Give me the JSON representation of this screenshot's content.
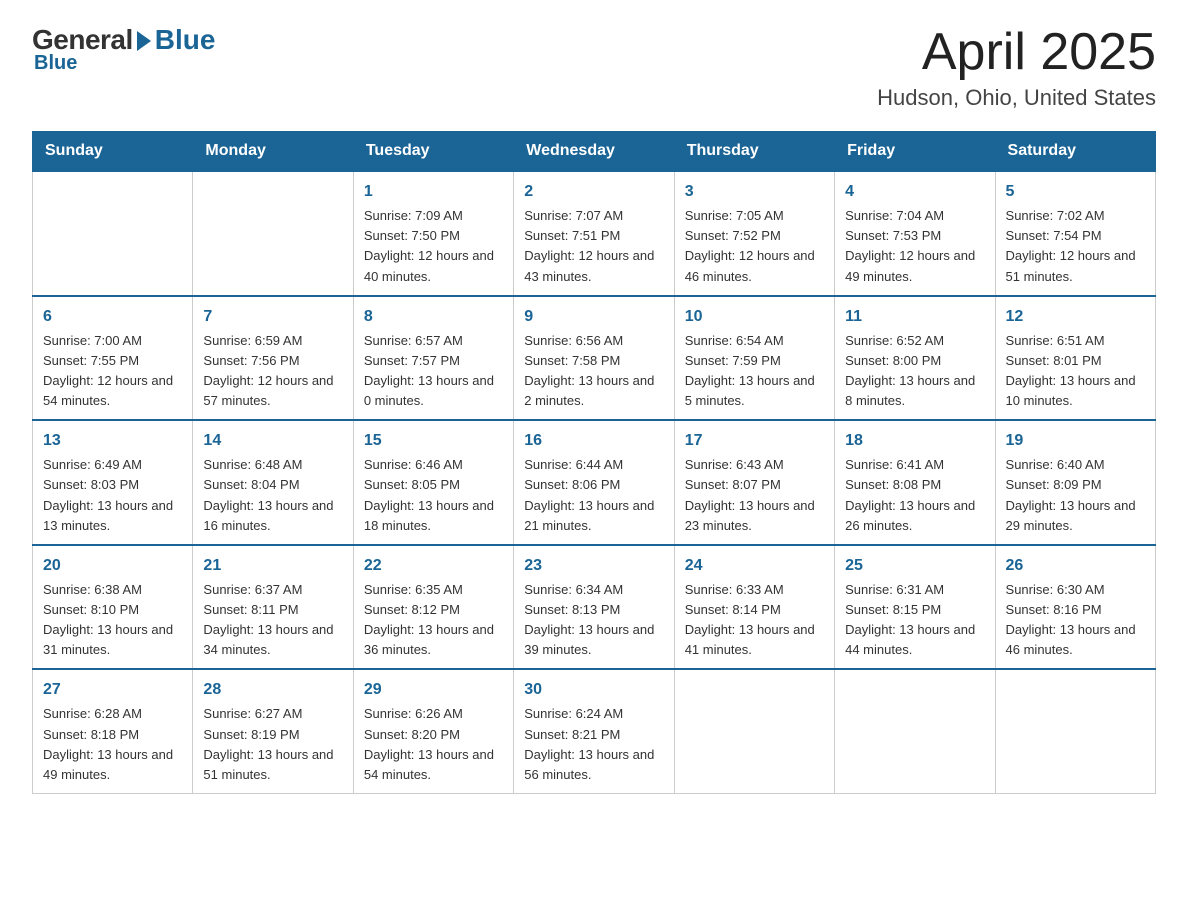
{
  "logo": {
    "general": "General",
    "blue": "Blue",
    "tagline": "Blue"
  },
  "header": {
    "month_year": "April 2025",
    "location": "Hudson, Ohio, United States"
  },
  "weekdays": [
    "Sunday",
    "Monday",
    "Tuesday",
    "Wednesday",
    "Thursday",
    "Friday",
    "Saturday"
  ],
  "weeks": [
    [
      {
        "day": "",
        "info": ""
      },
      {
        "day": "",
        "info": ""
      },
      {
        "day": "1",
        "info": "Sunrise: 7:09 AM\nSunset: 7:50 PM\nDaylight: 12 hours\nand 40 minutes."
      },
      {
        "day": "2",
        "info": "Sunrise: 7:07 AM\nSunset: 7:51 PM\nDaylight: 12 hours\nand 43 minutes."
      },
      {
        "day": "3",
        "info": "Sunrise: 7:05 AM\nSunset: 7:52 PM\nDaylight: 12 hours\nand 46 minutes."
      },
      {
        "day": "4",
        "info": "Sunrise: 7:04 AM\nSunset: 7:53 PM\nDaylight: 12 hours\nand 49 minutes."
      },
      {
        "day": "5",
        "info": "Sunrise: 7:02 AM\nSunset: 7:54 PM\nDaylight: 12 hours\nand 51 minutes."
      }
    ],
    [
      {
        "day": "6",
        "info": "Sunrise: 7:00 AM\nSunset: 7:55 PM\nDaylight: 12 hours\nand 54 minutes."
      },
      {
        "day": "7",
        "info": "Sunrise: 6:59 AM\nSunset: 7:56 PM\nDaylight: 12 hours\nand 57 minutes."
      },
      {
        "day": "8",
        "info": "Sunrise: 6:57 AM\nSunset: 7:57 PM\nDaylight: 13 hours\nand 0 minutes."
      },
      {
        "day": "9",
        "info": "Sunrise: 6:56 AM\nSunset: 7:58 PM\nDaylight: 13 hours\nand 2 minutes."
      },
      {
        "day": "10",
        "info": "Sunrise: 6:54 AM\nSunset: 7:59 PM\nDaylight: 13 hours\nand 5 minutes."
      },
      {
        "day": "11",
        "info": "Sunrise: 6:52 AM\nSunset: 8:00 PM\nDaylight: 13 hours\nand 8 minutes."
      },
      {
        "day": "12",
        "info": "Sunrise: 6:51 AM\nSunset: 8:01 PM\nDaylight: 13 hours\nand 10 minutes."
      }
    ],
    [
      {
        "day": "13",
        "info": "Sunrise: 6:49 AM\nSunset: 8:03 PM\nDaylight: 13 hours\nand 13 minutes."
      },
      {
        "day": "14",
        "info": "Sunrise: 6:48 AM\nSunset: 8:04 PM\nDaylight: 13 hours\nand 16 minutes."
      },
      {
        "day": "15",
        "info": "Sunrise: 6:46 AM\nSunset: 8:05 PM\nDaylight: 13 hours\nand 18 minutes."
      },
      {
        "day": "16",
        "info": "Sunrise: 6:44 AM\nSunset: 8:06 PM\nDaylight: 13 hours\nand 21 minutes."
      },
      {
        "day": "17",
        "info": "Sunrise: 6:43 AM\nSunset: 8:07 PM\nDaylight: 13 hours\nand 23 minutes."
      },
      {
        "day": "18",
        "info": "Sunrise: 6:41 AM\nSunset: 8:08 PM\nDaylight: 13 hours\nand 26 minutes."
      },
      {
        "day": "19",
        "info": "Sunrise: 6:40 AM\nSunset: 8:09 PM\nDaylight: 13 hours\nand 29 minutes."
      }
    ],
    [
      {
        "day": "20",
        "info": "Sunrise: 6:38 AM\nSunset: 8:10 PM\nDaylight: 13 hours\nand 31 minutes."
      },
      {
        "day": "21",
        "info": "Sunrise: 6:37 AM\nSunset: 8:11 PM\nDaylight: 13 hours\nand 34 minutes."
      },
      {
        "day": "22",
        "info": "Sunrise: 6:35 AM\nSunset: 8:12 PM\nDaylight: 13 hours\nand 36 minutes."
      },
      {
        "day": "23",
        "info": "Sunrise: 6:34 AM\nSunset: 8:13 PM\nDaylight: 13 hours\nand 39 minutes."
      },
      {
        "day": "24",
        "info": "Sunrise: 6:33 AM\nSunset: 8:14 PM\nDaylight: 13 hours\nand 41 minutes."
      },
      {
        "day": "25",
        "info": "Sunrise: 6:31 AM\nSunset: 8:15 PM\nDaylight: 13 hours\nand 44 minutes."
      },
      {
        "day": "26",
        "info": "Sunrise: 6:30 AM\nSunset: 8:16 PM\nDaylight: 13 hours\nand 46 minutes."
      }
    ],
    [
      {
        "day": "27",
        "info": "Sunrise: 6:28 AM\nSunset: 8:18 PM\nDaylight: 13 hours\nand 49 minutes."
      },
      {
        "day": "28",
        "info": "Sunrise: 6:27 AM\nSunset: 8:19 PM\nDaylight: 13 hours\nand 51 minutes."
      },
      {
        "day": "29",
        "info": "Sunrise: 6:26 AM\nSunset: 8:20 PM\nDaylight: 13 hours\nand 54 minutes."
      },
      {
        "day": "30",
        "info": "Sunrise: 6:24 AM\nSunset: 8:21 PM\nDaylight: 13 hours\nand 56 minutes."
      },
      {
        "day": "",
        "info": ""
      },
      {
        "day": "",
        "info": ""
      },
      {
        "day": "",
        "info": ""
      }
    ]
  ]
}
